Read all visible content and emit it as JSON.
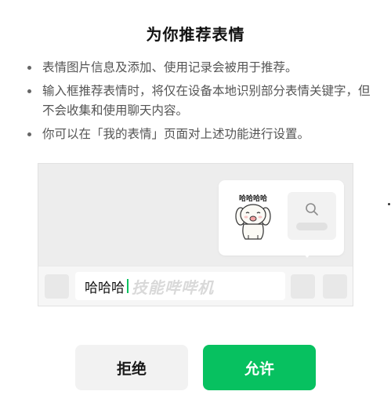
{
  "dialog": {
    "title": "为你推荐表情",
    "bullets": [
      "表情图片信息及添加、使用记录会被用于推荐。",
      "输入框推荐表情时，将仅在设备本地识别部分表情关键字，但不会收集和使用聊天内容。",
      "你可以在「我的表情」页面对上述功能进行设置。"
    ]
  },
  "illustration": {
    "sticker_text": "哈哈哈哈",
    "input_text": "哈哈哈",
    "watermark": "技能哔哔机"
  },
  "buttons": {
    "reject_label": "拒绝",
    "allow_label": "允许"
  },
  "colors": {
    "accent": "#07c160",
    "secondary_button_bg": "#f2f2f2",
    "illustration_bg": "#ededed"
  },
  "icons": [
    "search-icon",
    "sticker-dog-icon"
  ]
}
